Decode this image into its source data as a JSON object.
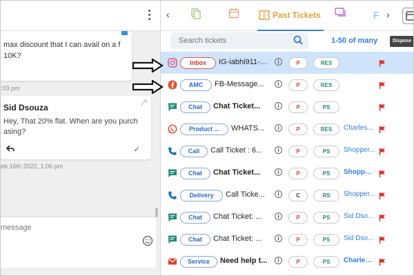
{
  "chat": {
    "message1": "max discount that I can avail on a f 10K?",
    "time1": ":03 pm",
    "sender": "Sid Dsouza",
    "message2": "Hey, That 20% flat. When are you purch asing?",
    "time2": "eb 16th 2022, 1:06 pm",
    "composer_placeholder": "message",
    "reply_icon": "reply-icon",
    "check_icon": "check-icon",
    "emoji_icon": "emoji-icon"
  },
  "tabs": {
    "active_label": "Past Tickets",
    "partial_label": "F"
  },
  "tooltip": "Dispose",
  "search": {
    "placeholder": "Search tickets"
  },
  "pager": "1-50 of many",
  "colors": {
    "accent": "#2f7de1",
    "active_tab_text": "#e2a23b",
    "priority_red": "#d3412f",
    "status_green": "#23866f",
    "selected_row": "#cfe4fb",
    "flag_red": "#e0322b"
  },
  "tickets": [
    {
      "channel_icon": "instagram-icon",
      "channel": "Inbox",
      "title": "IG-iabhi911-What i...",
      "bold": false,
      "priority": "P",
      "status": "RES",
      "assignee": "",
      "selected": true
    },
    {
      "channel_icon": "facebook-icon",
      "channel": "AMC",
      "title": "FB-Message...",
      "bold": false,
      "priority": "P",
      "status": "RES",
      "assignee": "",
      "selected": false
    },
    {
      "channel_icon": "chat-icon",
      "channel": "Chat",
      "title": "Chat Ticket...",
      "bold": true,
      "priority": "P",
      "status": "PS",
      "assignee": "",
      "selected": false
    },
    {
      "channel_icon": "whatsapp-icon",
      "channel": "Product ...",
      "title": "WHATS...",
      "bold": false,
      "priority": "P",
      "status": "RES",
      "assignee": "Charles...",
      "assignee_bold": false,
      "selected": false
    },
    {
      "channel_icon": "phone-icon",
      "channel": "Call",
      "title": "Call Ticket : 6...",
      "bold": false,
      "priority": "P",
      "status": "PS",
      "assignee": "Shopper...",
      "assignee_bold": false,
      "selected": false
    },
    {
      "channel_icon": "chat-icon",
      "channel": "Chat",
      "title": "Chat Ticket...",
      "bold": true,
      "priority": "P",
      "status": "PS",
      "assignee": "Shopper...",
      "assignee_bold": true,
      "selected": false
    },
    {
      "channel_icon": "phone-icon",
      "channel": "Delivery",
      "title": "Call Ticke...",
      "bold": false,
      "priority": "C",
      "status": "RS",
      "assignee": "Shopper...",
      "assignee_bold": false,
      "selected": false
    },
    {
      "channel_icon": "chat-icon",
      "channel": "Chat",
      "title": "Chat Ticket: ...",
      "bold": false,
      "priority": "P",
      "status": "PS",
      "assignee": "Sid Dsou...",
      "assignee_bold": false,
      "selected": false
    },
    {
      "channel_icon": "chat-icon",
      "channel": "Chat",
      "title": "Chat Ticket: ...",
      "bold": false,
      "priority": "P",
      "status": "PS",
      "assignee": "Sid Dsou...",
      "assignee_bold": false,
      "selected": false
    },
    {
      "channel_icon": "email-icon",
      "channel": "Service",
      "title": "Need help t...",
      "bold": true,
      "priority": "P",
      "status": "PS",
      "assignee": "Charles ...",
      "assignee_bold": true,
      "selected": false
    }
  ]
}
